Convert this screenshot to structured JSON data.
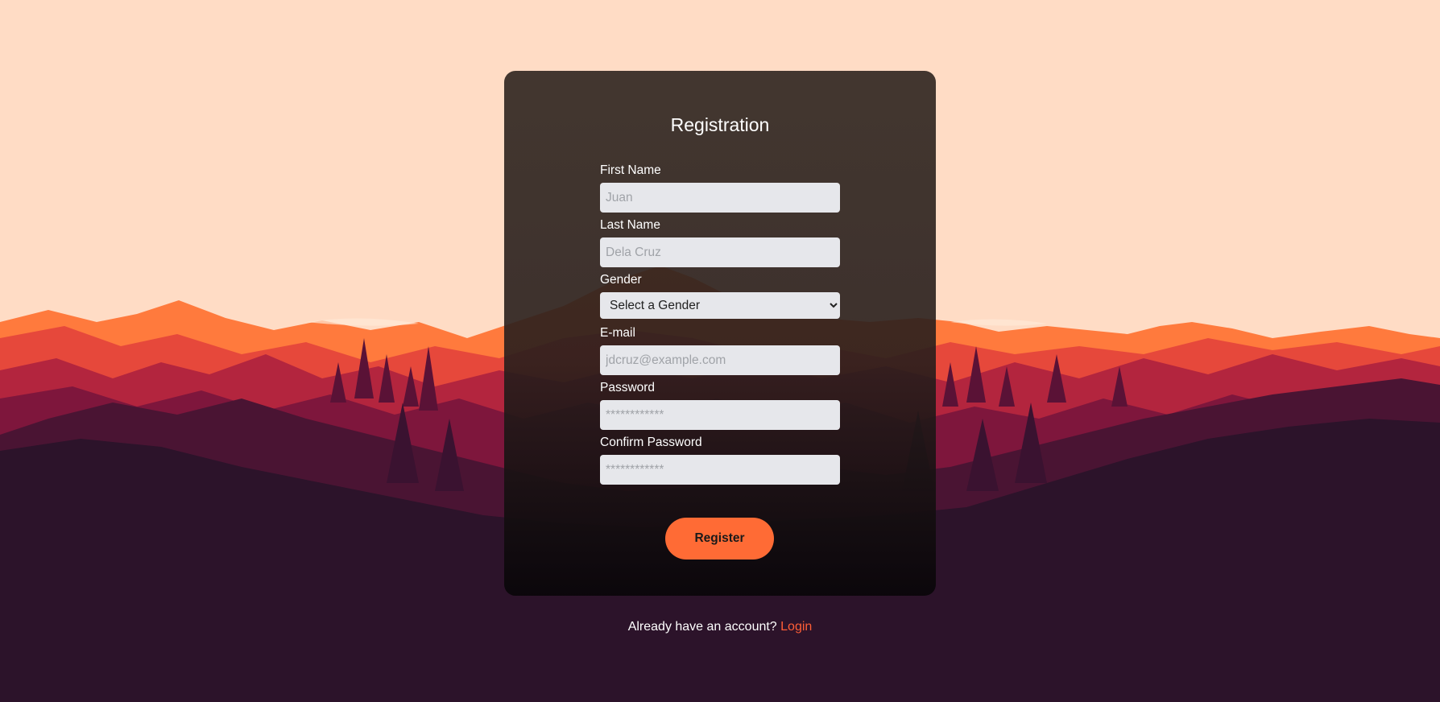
{
  "form": {
    "title": "Registration",
    "fields": [
      {
        "label": "First Name",
        "placeholder": "Juan"
      },
      {
        "label": "Last Name",
        "placeholder": "Dela Cruz"
      },
      {
        "label": "Gender",
        "selected": "Select a Gender"
      },
      {
        "label": "E-mail",
        "placeholder": "jdcruz@example.com"
      },
      {
        "label": "Password",
        "placeholder": "************"
      },
      {
        "label": "Confirm Password",
        "placeholder": "************"
      }
    ],
    "submit_label": "Register"
  },
  "footer": {
    "text": "Already have an account? ",
    "link_label": "Login"
  },
  "colors": {
    "sky": "#ffdcc5",
    "accent": "#ff6b35",
    "link": "#ff5e36",
    "ground": "#2c132a"
  }
}
